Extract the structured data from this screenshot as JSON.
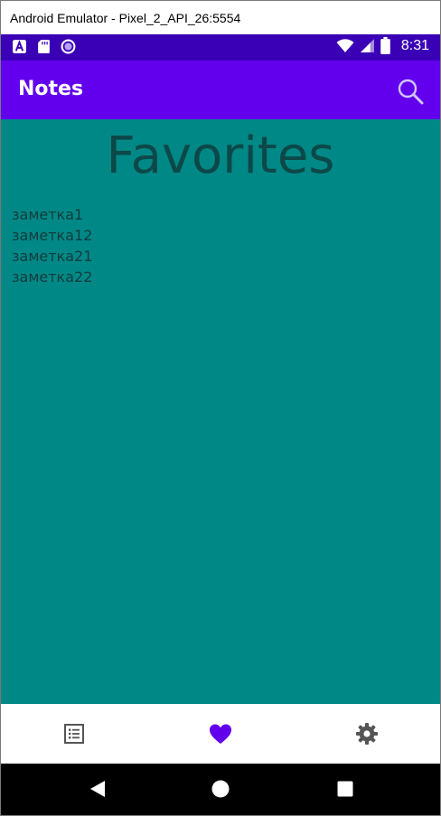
{
  "window": {
    "title": "Android Emulator - Pixel_2_API_26:5554"
  },
  "status_bar": {
    "time": "8:31",
    "background": "#3a00b6",
    "icons_left": [
      "a-notification-icon",
      "sd-card-icon",
      "circle-notification-icon"
    ],
    "icons_right": [
      "wifi-icon",
      "cell-signal-icon",
      "battery-icon"
    ]
  },
  "app_bar": {
    "title": "Notes",
    "background": "#6200ee",
    "action_icon": "search-icon"
  },
  "content": {
    "background": "#008887",
    "title": "Favorites",
    "notes": [
      "заметка1",
      "заметка12",
      "заметка21",
      "заметка22"
    ]
  },
  "bottom_nav": {
    "items": [
      {
        "icon": "list-icon",
        "selected": false
      },
      {
        "icon": "heart-icon",
        "selected": true
      },
      {
        "icon": "gear-icon",
        "selected": false
      }
    ],
    "selected_color": "#6200ee",
    "unselected_color": "#555555"
  },
  "system_nav": {
    "icons": [
      "back-icon",
      "home-icon",
      "recents-icon"
    ]
  }
}
